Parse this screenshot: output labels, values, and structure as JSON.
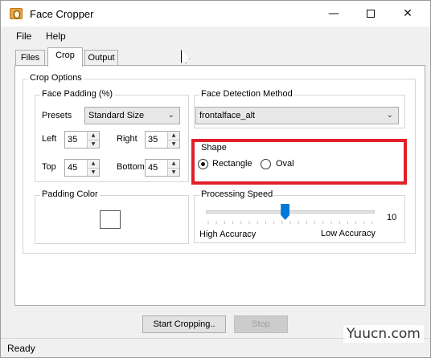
{
  "window": {
    "title": "Face Cropper",
    "controls": {
      "minimize": "—",
      "close": "✕"
    }
  },
  "menu": [
    "File",
    "Help"
  ],
  "tabs": [
    {
      "label": "Files",
      "active": false
    },
    {
      "label": "Crop",
      "active": true
    },
    {
      "label": "Output",
      "active": false
    }
  ],
  "crop_options": {
    "label": "Crop Options",
    "face_padding": {
      "label": "Face Padding (%)",
      "presets_label": "Presets",
      "presets_value": "Standard Size",
      "left_label": "Left",
      "left_value": "35",
      "right_label": "Right",
      "right_value": "35",
      "top_label": "Top",
      "top_value": "45",
      "bottom_label": "Bottom",
      "bottom_value": "45"
    },
    "padding_color": {
      "label": "Padding Color",
      "color": "#ffffff"
    },
    "detection": {
      "label": "Face Detection Method",
      "value": "frontalface_alt"
    },
    "shape": {
      "label": "Shape",
      "options": [
        {
          "label": "Rectangle",
          "selected": true
        },
        {
          "label": "Oval",
          "selected": false
        }
      ],
      "highlight_color": "#e0202a"
    },
    "processing_speed": {
      "label": "Processing Speed",
      "value": "10",
      "thumb_position_fraction": 0.47,
      "min_label": "High Accuracy",
      "max_label": "Low Accuracy"
    }
  },
  "buttons": {
    "start": "Start Cropping..",
    "stop": "Stop"
  },
  "status": "Ready",
  "watermark": "Yuucn.com",
  "accent": "#0078d7"
}
